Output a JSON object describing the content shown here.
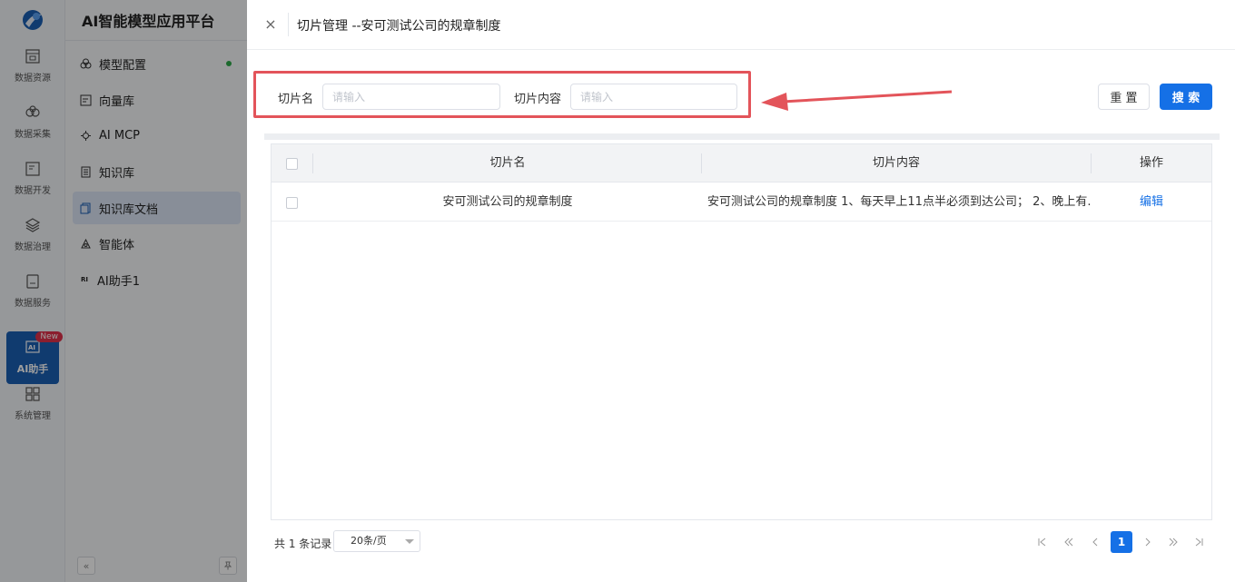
{
  "app": {
    "title": "AI智能模型应用平台"
  },
  "rail": {
    "items": [
      {
        "label": "数据资源",
        "icon": "database-icon"
      },
      {
        "label": "数据采集",
        "icon": "collect-icon"
      },
      {
        "label": "数据开发",
        "icon": "develop-icon"
      },
      {
        "label": "数据治理",
        "icon": "layers-icon"
      },
      {
        "label": "数据服务",
        "icon": "service-icon"
      },
      {
        "label": "AI助手",
        "icon": "ai-icon",
        "badge": "New",
        "active": true
      },
      {
        "label": "系统管理",
        "icon": "system-icon"
      }
    ]
  },
  "sidebar": {
    "items": [
      {
        "label": "模型配置",
        "icon": "model-icon"
      },
      {
        "label": "向量库",
        "icon": "vector-icon"
      },
      {
        "label": "AI MCP",
        "icon": "mcp-icon"
      },
      {
        "label": "知识库",
        "icon": "knowledge-icon"
      },
      {
        "label": "知识库文档",
        "icon": "document-icon",
        "active": true
      },
      {
        "label": "智能体",
        "icon": "agent-icon"
      },
      {
        "label": "AI助手1",
        "icon": "assistant-icon",
        "prefix": "RI"
      }
    ],
    "collapse_glyph": "«"
  },
  "drawer": {
    "title": "切片管理 --安可测试公司的规章制度",
    "close_glyph": "×",
    "search": {
      "name_label": "切片名",
      "name_placeholder": "请输入",
      "content_label": "切片内容",
      "content_placeholder": "请输入"
    },
    "buttons": {
      "reset": "重 置",
      "search": "搜 索"
    },
    "table": {
      "headers": [
        "切片名",
        "切片内容",
        "操作"
      ],
      "rows": [
        {
          "name": "安可测试公司的规章制度",
          "content": "安可测试公司的规章制度 1、每天早上11点半必须到达公司； 2、晚上有...",
          "action": "编辑"
        }
      ]
    },
    "pagination": {
      "total_text": "共 1 条记录",
      "page_size": "20条/页",
      "current_page": "1"
    }
  },
  "colors": {
    "accent": "#1570e6",
    "highlight": "#e3545a",
    "active_rail": "#1a5fb4"
  }
}
